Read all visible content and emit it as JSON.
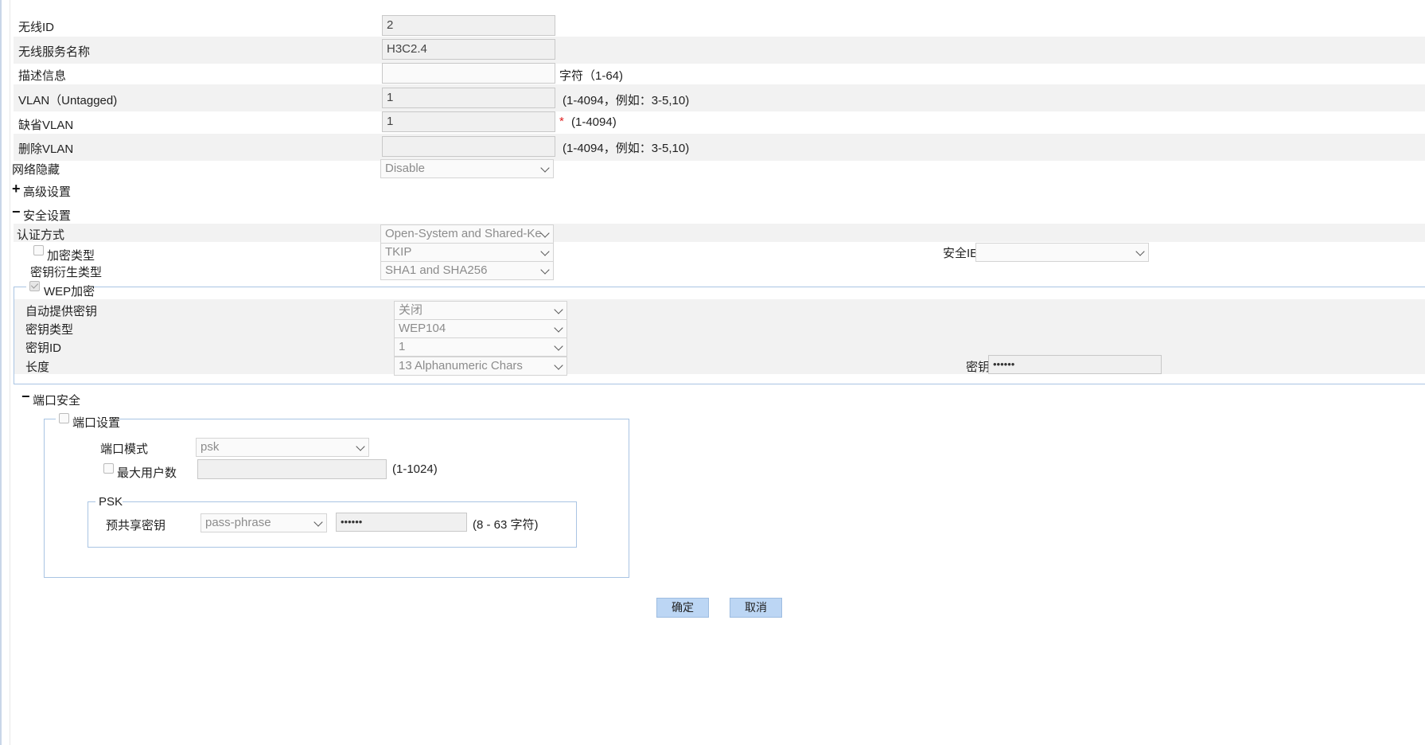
{
  "form": {
    "wireless_id": {
      "label": "无线ID",
      "value": "2"
    },
    "ssid": {
      "label": "无线服务名称",
      "value": "H3C2.4"
    },
    "description": {
      "label": "描述信息",
      "value": "",
      "hint": "字符（1-64)"
    },
    "vlan_untagged": {
      "label": "VLAN（Untagged)",
      "value": "1",
      "hint": "(1-4094，例如：3-5,10)"
    },
    "default_vlan": {
      "label": "缺省VLAN",
      "value": "1",
      "required_mark": "*",
      "hint": "(1-4094)"
    },
    "delete_vlan": {
      "label": "删除VLAN",
      "value": "",
      "hint": "(1-4094，例如：3-5,10)"
    },
    "network_hide": {
      "label": "网络隐藏",
      "value": "Disable"
    }
  },
  "advanced": {
    "toggle": "+",
    "label": "高级设置"
  },
  "security": {
    "toggle": "−",
    "label": "安全设置",
    "auth_method": {
      "label": "认证方式",
      "value": "Open-System and Shared-Ke"
    },
    "encryption_type": {
      "label": "加密类型",
      "value": "TKIP"
    },
    "security_ie": {
      "label": "安全IE",
      "value": ""
    },
    "key_derivation": {
      "label": "密钥衍生类型",
      "value": "SHA1 and SHA256"
    },
    "wep": {
      "legend": "WEP加密",
      "auto_key": {
        "label": "自动提供密钥",
        "value": "关闭"
      },
      "key_type": {
        "label": "密钥类型",
        "value": "WEP104"
      },
      "key_id": {
        "label": "密钥ID",
        "value": "1"
      },
      "length": {
        "label": "长度",
        "value": "13 Alphanumeric Chars"
      },
      "key": {
        "label": "密钥",
        "value": "••••••"
      }
    }
  },
  "port_security": {
    "toggle": "−",
    "label": "端口安全",
    "port_settings": {
      "legend": "端口设置",
      "port_mode": {
        "label": "端口模式",
        "value": "psk"
      },
      "max_users": {
        "label": "最大用户数",
        "value": "",
        "hint": "(1-1024)"
      },
      "psk": {
        "legend": "PSK",
        "label": "预共享密钥",
        "type_value": "pass-phrase",
        "key_value": "••••••",
        "hint": "(8 - 63 字符)"
      }
    }
  },
  "buttons": {
    "ok": "确定",
    "cancel": "取消"
  }
}
